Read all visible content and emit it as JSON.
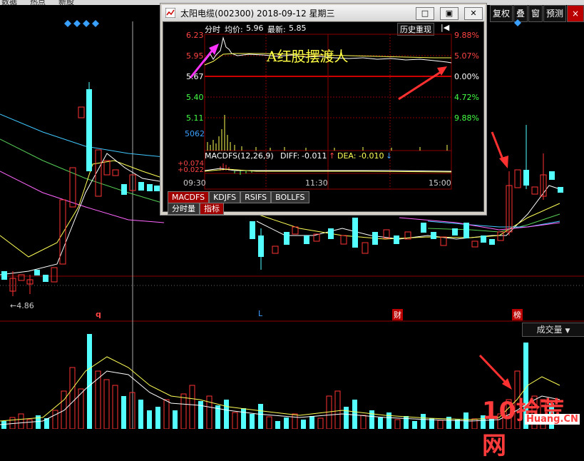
{
  "menu": {
    "items": [
      "数据",
      "热点",
      "新股"
    ]
  },
  "toolbar": {
    "buttons": [
      "复权",
      "叠",
      "窗",
      "预测"
    ],
    "close": "×"
  },
  "main_chart": {
    "low_label": "←4.86",
    "markers": {
      "q": "q",
      "l": "L",
      "cai": "财",
      "bang": "榜"
    }
  },
  "volume_panel": {
    "dropdown": "成交量"
  },
  "popup": {
    "title": "太阳电缆(002300) 2018-09-12 星期三",
    "win_buttons": [
      "□",
      "▣",
      "✕"
    ],
    "header": {
      "tab": "分时",
      "avg_label": "均价:",
      "avg_value": "5.96",
      "last_label": "最新:",
      "last_value": "5.85",
      "history_button": "历史重现",
      "back_icon": "|◀"
    },
    "price_labels_left": [
      "6.23",
      "5.95",
      "5.67",
      "5.40",
      "5.11"
    ],
    "pct_labels_right": [
      "9.88%",
      "5.07%",
      "0.00%",
      "4.72%",
      "9.88%"
    ],
    "volume_label": "5062",
    "watermark": "A红股摆渡人",
    "macd": {
      "name": "MACDFS(12,26,9)",
      "diff_label": "DIFF:",
      "diff_value": "-0.011",
      "diff_arrow": "↑",
      "dea_label": "DEA:",
      "dea_value": "-0.010",
      "dea_arrow": "↓",
      "val1": "+0.074",
      "val2": "+0.022"
    },
    "time_labels": [
      "09:30",
      "11:30",
      "15:00"
    ],
    "indicator_tabs": [
      "MACDFS",
      "KDJFS",
      "RSIFS",
      "BOLLFS"
    ],
    "bottom_tabs": [
      "分时量",
      "指标"
    ]
  },
  "logo": {
    "text": "10拾荒网",
    "sub": "Huang.CN"
  },
  "colors": {
    "up": "#ff3333",
    "down": "#54ffff",
    "grid": "#8b0000",
    "yellow": "#ffff55"
  }
}
